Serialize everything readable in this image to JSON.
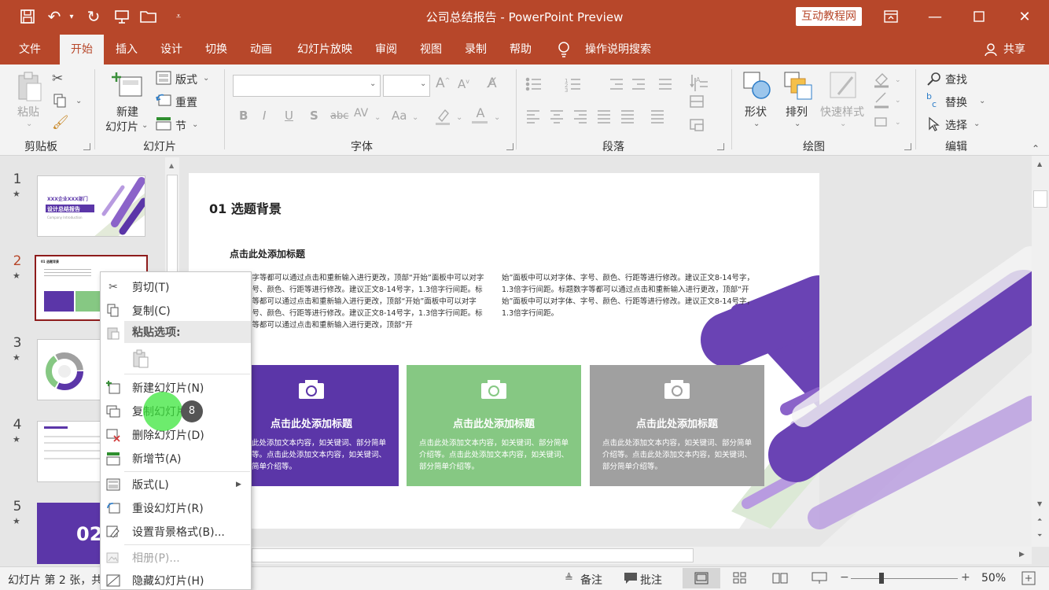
{
  "titlebar": {
    "doc_title": "公司总结报告  -  PowerPoint Preview",
    "brand_badge": "互动教程网"
  },
  "tabs": [
    "文件",
    "开始",
    "插入",
    "设计",
    "切换",
    "动画",
    "幻灯片放映",
    "审阅",
    "视图",
    "录制",
    "帮助"
  ],
  "active_tab": "开始",
  "tell_me": "操作说明搜索",
  "share": "共享",
  "ribbon": {
    "clipboard": {
      "label": "剪贴板",
      "paste": "粘贴"
    },
    "slides": {
      "label": "幻灯片",
      "new_slide_1": "新建",
      "new_slide_2": "幻灯片",
      "layout": "版式",
      "reset": "重置",
      "section": "节"
    },
    "font": {
      "label": "字体",
      "format_buttons": [
        "B",
        "I",
        "U",
        "S",
        "abc",
        "AV",
        "Aa",
        "A"
      ]
    },
    "paragraph": {
      "label": "段落"
    },
    "drawing": {
      "label": "绘图",
      "shapes": "形状",
      "arrange": "排列",
      "quick_styles": "快速样式"
    },
    "editing": {
      "label": "编辑",
      "find": "查找",
      "replace": "替换",
      "select": "选择"
    }
  },
  "thumbnails": [
    {
      "num": "1",
      "line1": "XXX企业XXX部门",
      "line2": "设计总结报告",
      "line3": "Company Introduction"
    },
    {
      "num": "2",
      "title": "01 选题背景"
    },
    {
      "num": "3"
    },
    {
      "num": "4"
    },
    {
      "num": "5",
      "big": "02"
    }
  ],
  "slide": {
    "heading": "01 选题背景",
    "subheading": "点击此处添加标题",
    "col1": "标题数字等都可以通过点击和重新输入进行更改，顶部“开始”面板中可以对字体、字号、颜色、行距等进行修改。建议正文8-14号字，1.3倍字行间距。标题数字等都可以通过点击和重新输入进行更改，顶部“开始”面板中可以对字体、字号、颜色、行距等进行修改。建议正文8-14号字，1.3倍字行间距。标题数字等都可以通过点击和重新输入进行更改，顶部“开",
    "col2": "始”面板中可以对字体、字号、颜色、行距等进行修改。建议正文8-14号字，1.3倍字行间距。标题数字等都可以通过点击和重新输入进行更改，顶部“开始”面板中可以对字体、字号、颜色、行距等进行修改。建议正文8-14号字，1.3倍字行间距。",
    "cards": [
      {
        "title": "点击此处添加标题",
        "body": "点击此处添加文本内容，如关键词、部分简单介绍等。点击此处添加文本内容，如关键词、部分简单介绍等。",
        "color": "#5b36a8"
      },
      {
        "title": "点击此处添加标题",
        "body": "点击此处添加文本内容，如关键词、部分简单介绍等。点击此处添加文本内容，如关键词、部分简单介绍等。",
        "color": "#86c883"
      },
      {
        "title": "点击此处添加标题",
        "body": "点击此处添加文本内容，如关键词、部分简单介绍等。点击此处添加文本内容，如关键词、部分简单介绍等。",
        "color": "#a0a0a0"
      }
    ]
  },
  "context_menu": {
    "cut": "剪切(T)",
    "copy": "复制(C)",
    "paste_options": "粘贴选项:",
    "new_slide": "新建幻灯片(N)",
    "duplicate": "复制幻灯片(A)",
    "delete": "删除幻灯片(D)",
    "add_section": "新增节(A)",
    "layout": "版式(L)",
    "reset": "重设幻灯片(R)",
    "format_bg": "设置背景格式(B)...",
    "photo_album": "相册(P)...",
    "hide": "隐藏幻灯片(H)"
  },
  "cursor_badge": "8",
  "status": {
    "slide_info": "幻灯片 第 2 张，共",
    "notes": "备注",
    "comments": "批注",
    "zoom": "50%"
  }
}
